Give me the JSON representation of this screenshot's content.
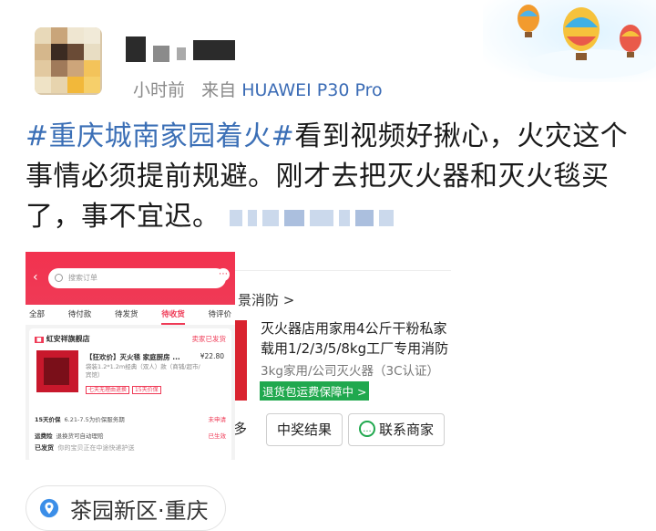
{
  "header": {
    "time_prefix": "小时前",
    "from_label": "来自",
    "device": "HUAWEI P30 Pro"
  },
  "post": {
    "hashtag": "#重庆城南家园着火#",
    "text": "看到视频好揪心，火灾这个事情必须提前规避。刚才去把灭火器和灭火毯买了，事不宜迟。"
  },
  "image_left": {
    "search_placeholder": "搜索订单",
    "tabs": [
      "全部",
      "待付款",
      "待发货",
      "待收货",
      "待评价"
    ],
    "active_tab": "待收货",
    "shop_name": "虹安祥旗舰店",
    "status": "卖家已发货",
    "product_title": "【狂欢价】灭火毯 家庭厨房 ...",
    "price": "¥22.80",
    "spec": "袋装1.2*1.2m经典（双人）款（商铺/超市/宾馆）",
    "qty": "×1",
    "badge_1": "七天无理由退换",
    "badge_2": "15天价保",
    "row_1_label": "15天价保",
    "row_1_text": "6.21-7.5为价保服务期",
    "row_1_right": "未申请",
    "row_2_label": "运费险",
    "row_2_text": "退换货可自动理赔",
    "row_2_right": "已生效",
    "shipping_label": "已发货",
    "shipping_text": "你的宝贝正在中途快递护送"
  },
  "image_right": {
    "store_link": "景消防 >",
    "product_name": "灭火器店用家用4公斤干粉私家载用1/2/3/5/8kg工厂专用消防",
    "product_sub": "3kg家用/公司灭火器（3C认证）",
    "return_badge": "退货包运费保障中 >",
    "btn_more": "多",
    "btn_prize": "中奖结果",
    "btn_contact": "联系商家"
  },
  "location": {
    "label": "茶园新区·重庆"
  },
  "colors": {
    "hashtag": "#3b6fb6",
    "app_red": "#ef3a56",
    "green": "#20a84e"
  }
}
